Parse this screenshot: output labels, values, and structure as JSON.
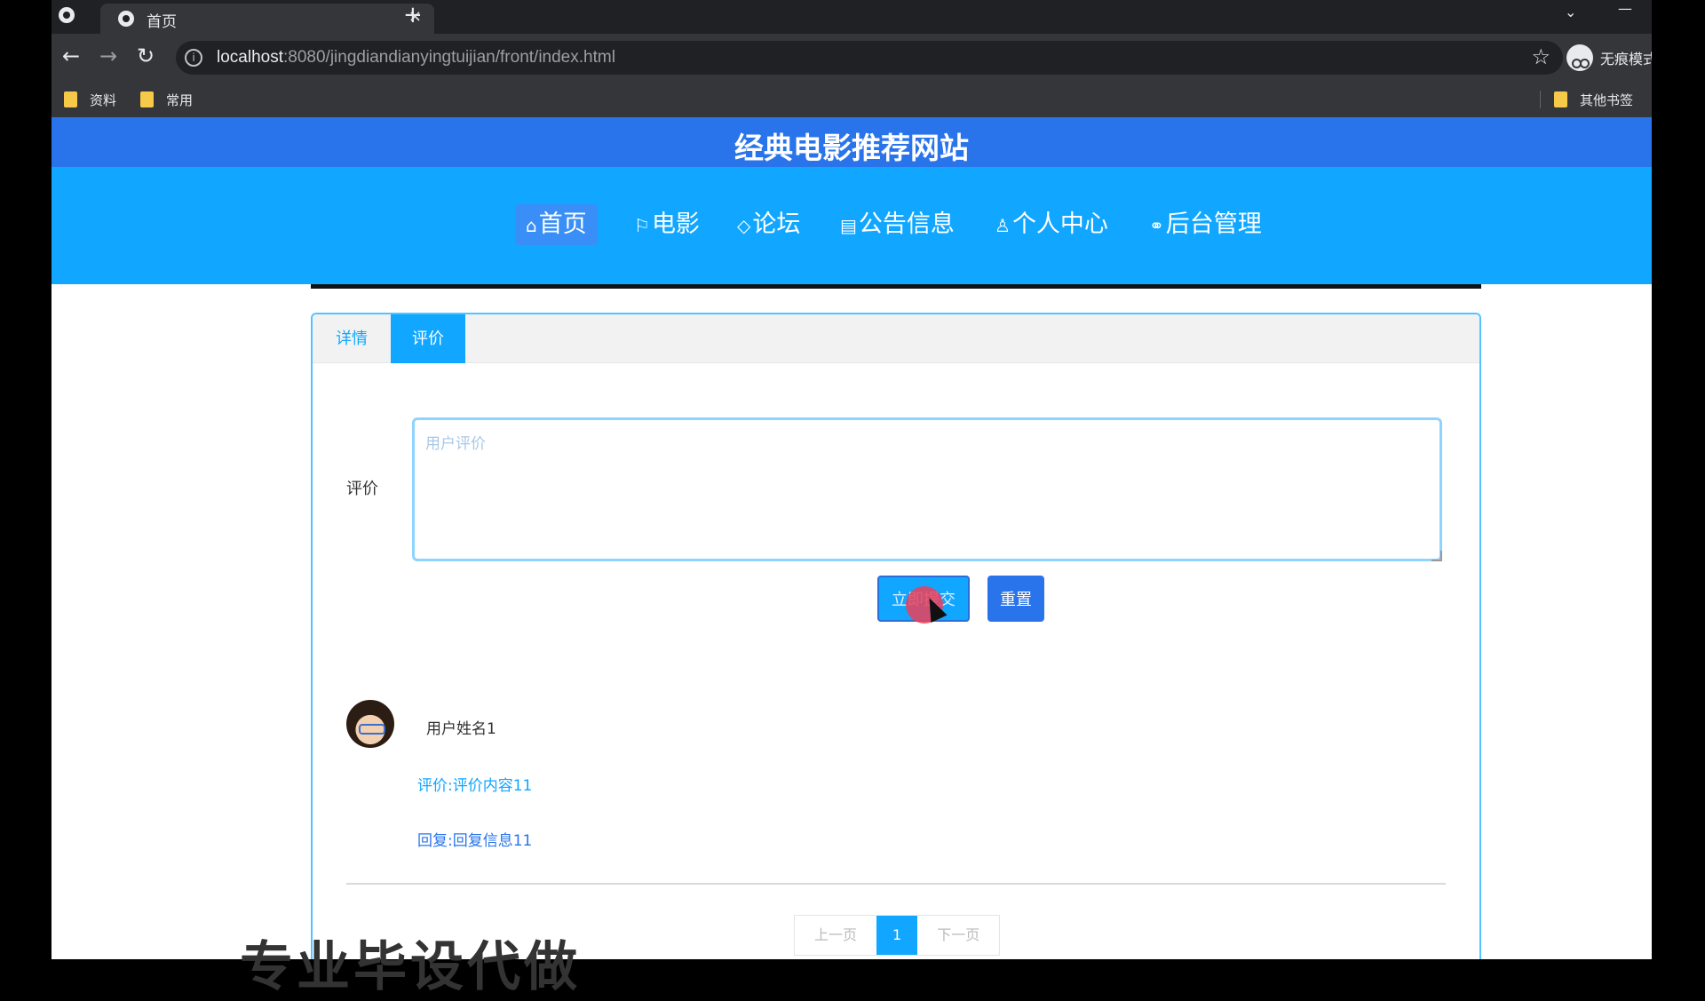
{
  "browser": {
    "tab_title": "首页",
    "new_tab": "+",
    "close": "×",
    "url_host": "localhost",
    "url_rest": ":8080/jingdiandianyingtuijian/front/index.html",
    "profile_label": "无痕模式",
    "bookmarks": [
      "资料",
      "常用"
    ],
    "other_bookmarks": "其他书签"
  },
  "site": {
    "title": "经典电影推荐网站",
    "nav": [
      {
        "icon": "⌂",
        "label": "首页"
      },
      {
        "icon": "⚐",
        "label": "电影"
      },
      {
        "icon": "◇",
        "label": "论坛"
      },
      {
        "icon": "▤",
        "label": "公告信息"
      },
      {
        "icon": "♙",
        "label": "个人中心"
      },
      {
        "icon": "⚭",
        "label": "后台管理"
      }
    ]
  },
  "detail": {
    "tabs": [
      "详情",
      "评价"
    ],
    "active_tab": "评价",
    "form": {
      "label": "评价",
      "placeholder": "用户评价",
      "value": "",
      "submit": "立即提交",
      "reset": "重置"
    },
    "comments": [
      {
        "user": "用户姓名1",
        "review": "评价:评价内容11",
        "reply": "回复:回复信息11"
      }
    ],
    "pager": {
      "prev": "上一页",
      "current": "1",
      "next": "下一页"
    }
  },
  "overlay": "专业毕设代做",
  "colors": {
    "header": "#2a74eb",
    "nav": "#11a6ff",
    "accent": "#11a6ff"
  }
}
